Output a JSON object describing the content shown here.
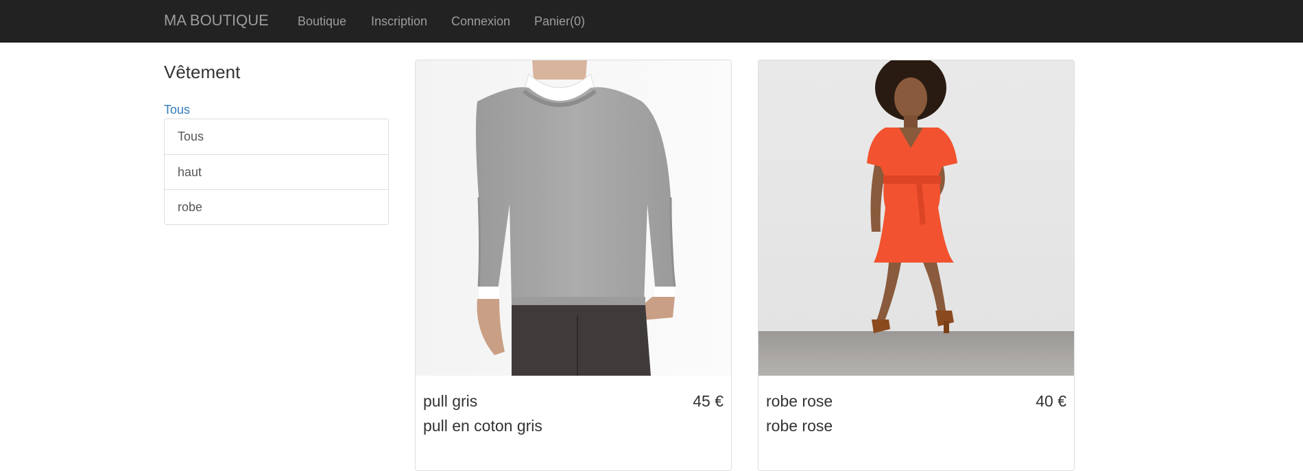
{
  "navbar": {
    "brand": "MA BOUTIQUE",
    "links": [
      "Boutique",
      "Inscription",
      "Connexion",
      "Panier(0)"
    ]
  },
  "sidebar": {
    "title": "Vêtement",
    "current_category": "Tous",
    "categories": [
      "Tous",
      "haut",
      "robe"
    ]
  },
  "products": [
    {
      "name": "pull gris",
      "price": "45 €",
      "description": "pull en coton gris"
    },
    {
      "name": "robe rose",
      "price": "40 €",
      "description": "robe rose"
    }
  ],
  "colors": {
    "navbar_bg": "#222222",
    "navbar_text": "#9d9d9d",
    "link": "#337ab7",
    "sweater": "#a3a3a3",
    "dress": "#f2522f"
  }
}
